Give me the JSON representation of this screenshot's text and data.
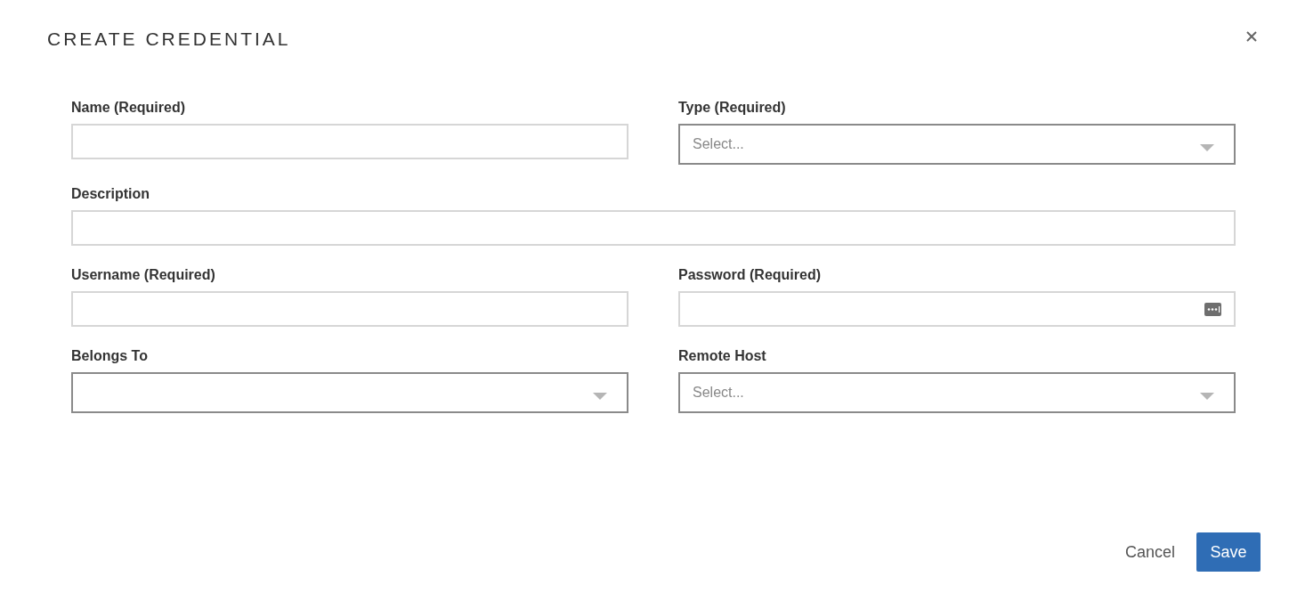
{
  "dialog": {
    "title": "CREATE CREDENTIAL"
  },
  "rows": [
    [
      {
        "label": "Name (Required)",
        "kind": "text"
      },
      {
        "label": "Type (Required)",
        "kind": "select",
        "placeholder": "Select..."
      }
    ],
    [
      {
        "label": "Description",
        "kind": "text"
      }
    ],
    [
      {
        "label": "Username (Required)",
        "kind": "text"
      },
      {
        "label": "Password (Required)",
        "kind": "password"
      }
    ],
    [
      {
        "label": "Belongs To",
        "kind": "select"
      },
      {
        "label": "Remote Host",
        "kind": "select",
        "placeholder": "Select..."
      }
    ]
  ],
  "buttons": {
    "cancel": "Cancel",
    "save": "Save"
  }
}
